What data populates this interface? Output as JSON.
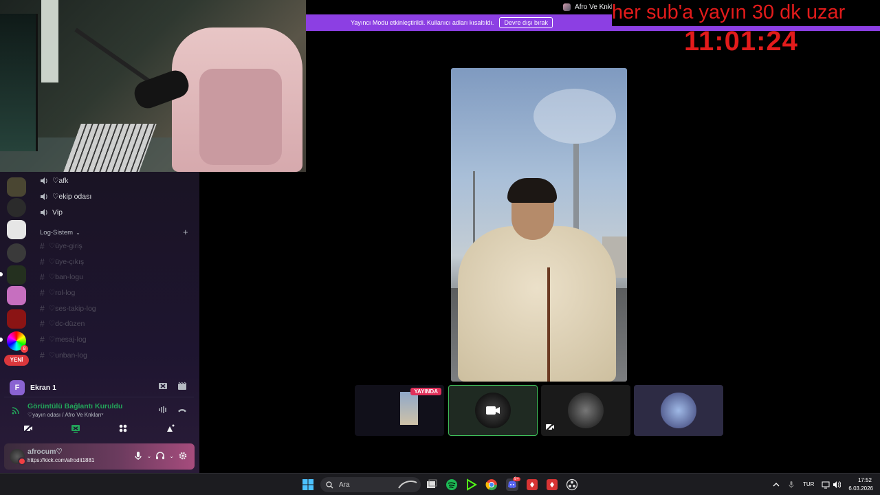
{
  "discord": {
    "voice_channels": [
      "♡afk",
      "♡ekip odası",
      "Vip"
    ],
    "category": "Log-Sistem",
    "text_channels": [
      "♡üye-giriş",
      "♡üye-çıkış",
      "♡ban-logu",
      "♡rol-log",
      "♡ses-takip-log",
      "♡dc-düzen",
      "♡mesaj-log",
      "♡unban-log"
    ],
    "new_badge": "YENİ",
    "server_badge": "8",
    "screen_panel": {
      "avatar_letter": "F",
      "title": "Ekran 1"
    },
    "voice_connection": {
      "title": "Görüntülü Bağlantı Kuruldu",
      "subtitle": "♡yayın odası / Afro Ve Knklarıᵛ"
    },
    "user": {
      "name": "afrocum♡",
      "status": "https://kick.com/afrodit1881"
    }
  },
  "top_banner": {
    "server_title": "Afro Ve Knklarıᵛ",
    "streamer_mode_text": "Yayıncı Modu etkinleştirildi. Kullanıcı adları kısaltıldı.",
    "disable_button": "Devre dışı bırak"
  },
  "overlay": {
    "sub_text": "her sub'a yayın 30 dk uzar",
    "timer": "11:01:24",
    "color": "#e21b1b"
  },
  "thumbnails": {
    "live_badge": "YAYINDA"
  },
  "taskbar": {
    "search_placeholder": "Ara",
    "language": "TUR",
    "time": "17:52",
    "date": "6.03.2026",
    "discord_badge": "9+"
  },
  "colors": {
    "streamer_bar": "#8c3fe3",
    "connected_green": "#23a55a",
    "live_red": "#e0305a"
  }
}
